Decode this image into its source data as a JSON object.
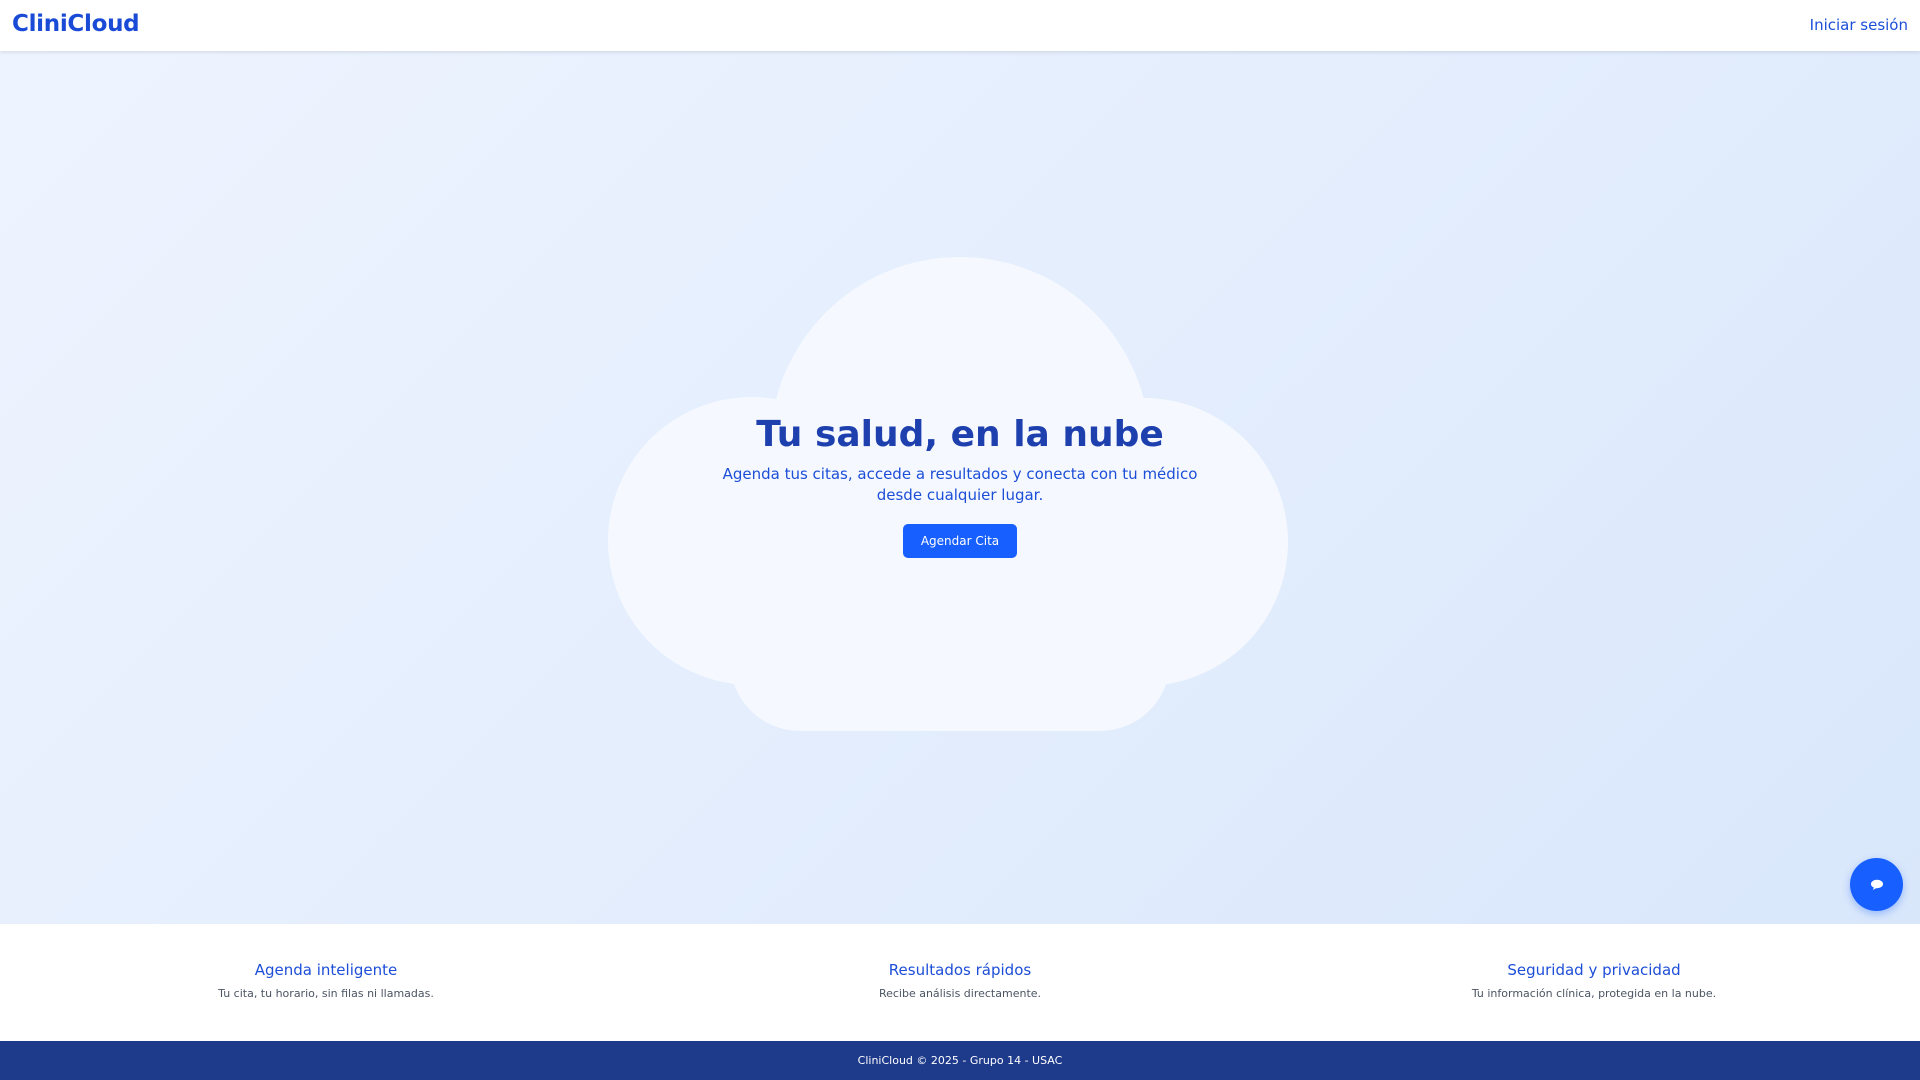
{
  "navbar": {
    "brand": "CliniCloud",
    "login_label": "Iniciar sesión"
  },
  "hero": {
    "title": "Tu salud, en la nube",
    "subtitle": "Agenda tus citas, accede a resultados y conecta con tu médico desde cualquier lugar.",
    "cta_label": "Agendar Cita"
  },
  "features": [
    {
      "title": "Agenda inteligente",
      "description": "Tu cita, tu horario, sin filas ni llamadas."
    },
    {
      "title": "Resultados rápidos",
      "description": "Recibe análisis directamente."
    },
    {
      "title": "Seguridad y privacidad",
      "description": "Tu información clínica, protegida en la nube."
    }
  ],
  "footer": {
    "text": "CliniCloud © 2025 - Grupo 14 - USAC"
  },
  "chat": {
    "icon": "chat-bubble-icon"
  },
  "colors": {
    "brand": "#1a4bd6",
    "title": "#1e40af",
    "button": "#1760ff",
    "footer_bg": "#1e3a8a",
    "hero_bg": "#e3edfd",
    "cloud": "#f5f9ff"
  }
}
